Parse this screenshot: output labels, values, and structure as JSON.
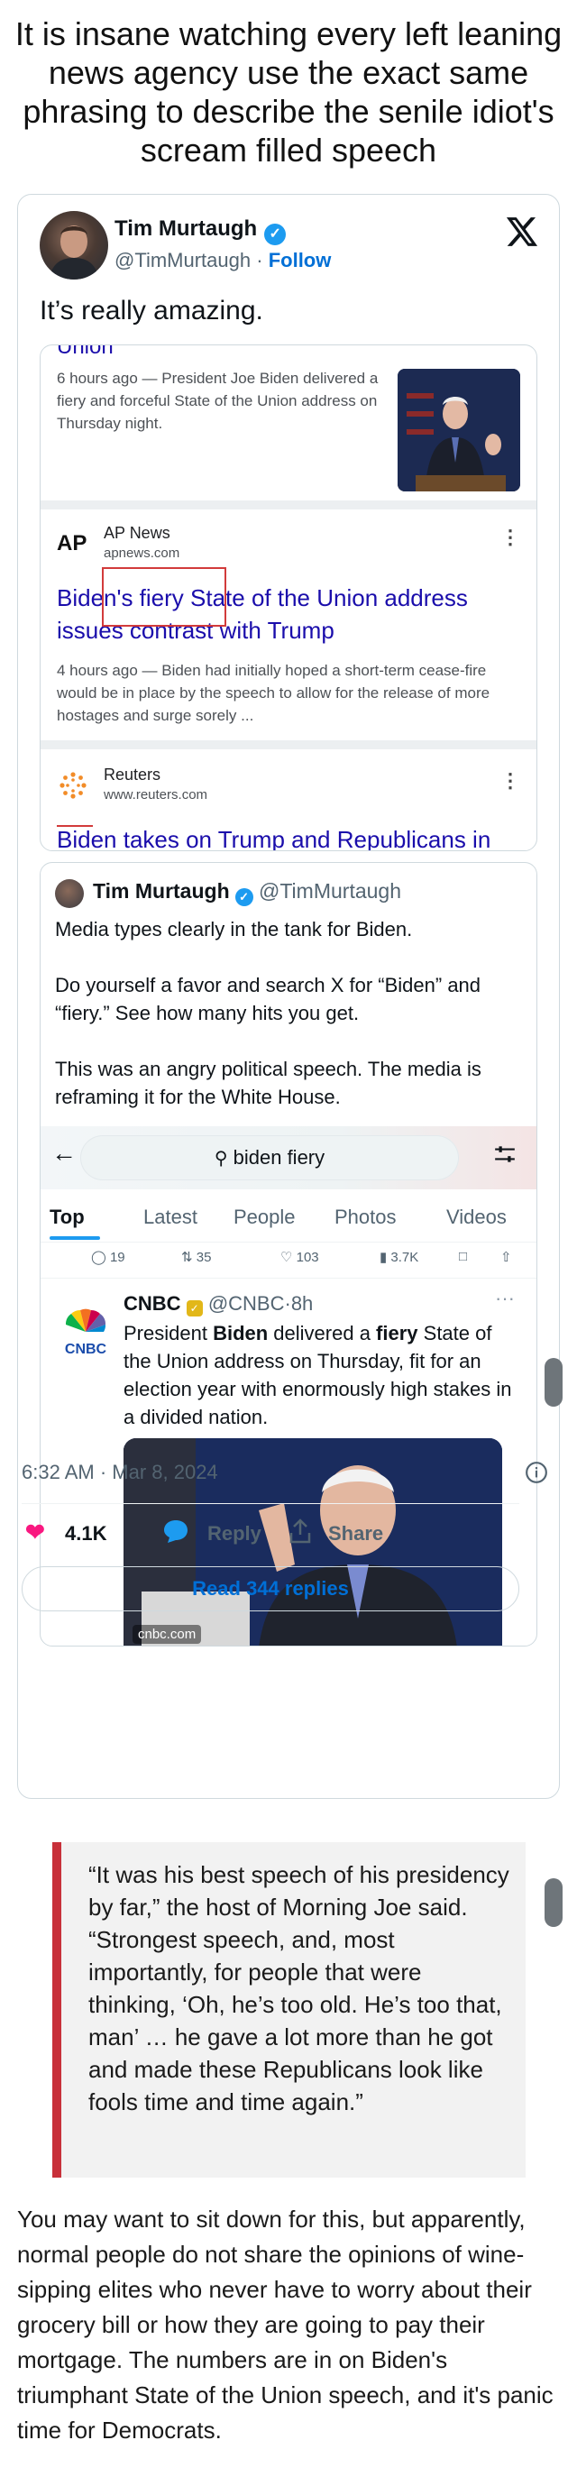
{
  "headline": "It is insane watching every left leaning news agency use the exact same phrasing to describe the senile idiot's scream filled speech",
  "tweet": {
    "author_name": "Tim Murtaugh",
    "author_handle": "@TimMurtaugh",
    "separator": "·",
    "follow_label": "Follow",
    "text": "It’s really amazing.",
    "timestamp": "6:32 AM · Mar 8, 2024",
    "likes": "4.1K",
    "reply_label": "Reply",
    "share_label": "Share",
    "read_replies_label": "Read 344 replies"
  },
  "news_results": {
    "first": {
      "cut_title": "Union",
      "meta": "6 hours ago — President Joe Biden delivered a fiery and forceful State of the Union address on Thursday night."
    },
    "ap": {
      "logo": "AP",
      "source": "AP News",
      "url": "apnews.com",
      "title": "Biden's fiery State of the Union address issues contrast with Trump",
      "meta": "4 hours ago — Biden had initially hoped a short-term cease-fire would be in place by the speech to allow for the release of more hostages and surge sorely ..."
    },
    "reuters": {
      "source": "Reuters",
      "url": "www.reuters.com",
      "cut_title": "Biden takes on Trump and Republicans in"
    }
  },
  "quoted": {
    "author_name": "Tim Murtaugh",
    "author_handle": "@TimMurtaugh",
    "paragraph1": "Media types clearly in the tank for Biden.",
    "paragraph2": "Do yourself a favor and search X for “Biden” and “fiery.” See how many hits you get.",
    "paragraph3": "This was an angry political speech. The media is reframing it for the White House.",
    "search_query": "biden fiery",
    "tabs": [
      "Top",
      "Latest",
      "People",
      "Photos",
      "Videos"
    ],
    "stats": {
      "replies": "19",
      "reposts": "35",
      "likes": "103",
      "views": "3.7K"
    },
    "cnbc": {
      "name": "CNBC",
      "handle": "@CNBC",
      "time": "8h",
      "text_before_biden": "President ",
      "bold_biden": "Biden",
      "text_middle": " delivered a ",
      "bold_fiery": "fiery",
      "text_after": " State of the Union address on Thursday, fit for an election year with enormously high stakes in a divided nation.",
      "image_caption": "cnbc.com"
    }
  },
  "blockquote": "“It was his best speech of his presidency by far,” the host of Morning Joe said. “Strongest speech, and, most importantly, for people that were thinking, ‘Oh, he’s too old. He’s too that, man’ … he gave a lot more than he got and made these Republicans look like fools time and time again.”",
  "body_paragraph": "You may want to sit down for this, but apparently, normal people do not share the opinions of wine-sipping elites who never have to worry about their grocery bill or how they are going to pay their mortgage. The numbers are in on Biden's triumphant State of the Union speech, and it's panic time for Democrats.",
  "colors": {
    "link_blue": "#006fd6",
    "verified_blue": "#1d9bf0",
    "google_link": "#1a0dab",
    "like_pink": "#f91880",
    "quote_bar_red": "#c8303a",
    "annotation_red": "#d23b3b"
  }
}
